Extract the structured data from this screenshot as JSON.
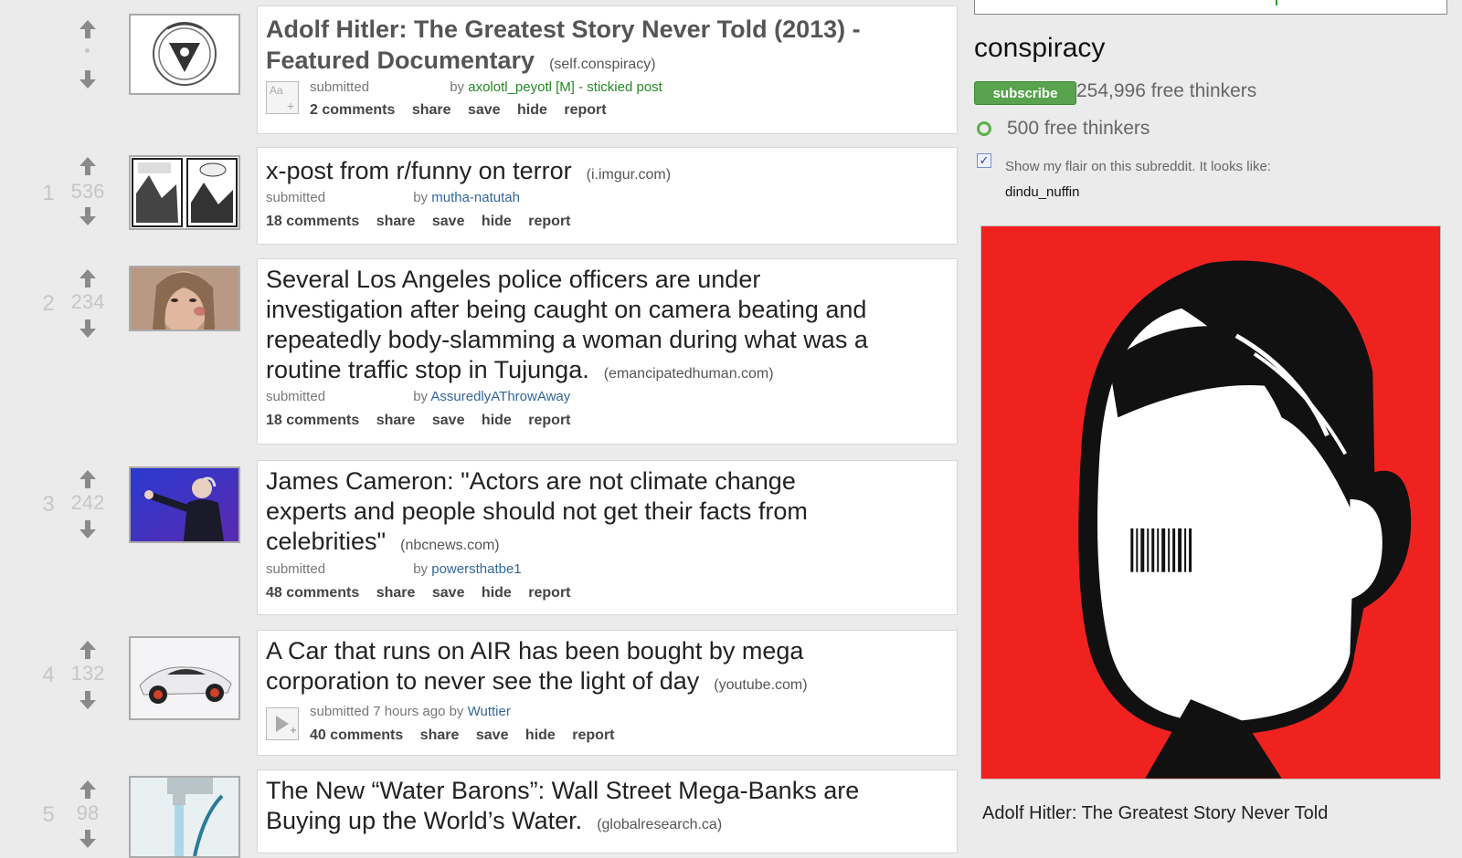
{
  "posts": [
    {
      "rank": "",
      "score": "",
      "title": "Adolf Hitler: The Greatest Story Never Told (2013) -",
      "title_line2": "Featured Documentary",
      "domain": "(self.conspiracy)",
      "submitted": "submitted",
      "by": "by",
      "author": "axolotl_peyotl",
      "author_extra": "[M] - stickied post",
      "comments": "2 comments",
      "share": "share",
      "save": "save",
      "hide": "hide",
      "report": "report"
    },
    {
      "rank": "1",
      "score": "536",
      "title": "x-post from r/funny on terror",
      "domain": "(i.imgur.com)",
      "submitted": "submitted",
      "by": "by",
      "author": "mutha-natutah",
      "comments": "18 comments",
      "share": "share",
      "save": "save",
      "hide": "hide",
      "report": "report"
    },
    {
      "rank": "2",
      "score": "234",
      "title_lines": [
        "Several Los Angeles police officers are under",
        "investigation after being caught on camera beating and",
        "repeatedly body-slamming a woman during what was a",
        "routine traffic stop in Tujunga."
      ],
      "domain": "(emancipatedhuman.com)",
      "submitted": "submitted",
      "by": "by",
      "author": "AssuredlyAThrowAway",
      "comments": "18 comments",
      "share": "share",
      "save": "save",
      "hide": "hide",
      "report": "report"
    },
    {
      "rank": "3",
      "score": "242",
      "title_lines": [
        "James Cameron: \"Actors are not climate change",
        "experts and people should not get their facts from",
        "celebrities\""
      ],
      "domain": "(nbcnews.com)",
      "submitted": "submitted",
      "by": "by",
      "author": "powersthatbe1",
      "comments": "48 comments",
      "share": "share",
      "save": "save",
      "hide": "hide",
      "report": "report"
    },
    {
      "rank": "4",
      "score": "132",
      "title_lines": [
        "A Car that runs on AIR has been bought by mega",
        "corporation to never see the light of day"
      ],
      "domain": "(youtube.com)",
      "submitted_full": "submitted 7 hours ago by",
      "author": "Wuttier",
      "comments": "40 comments",
      "share": "share",
      "save": "save",
      "hide": "hide",
      "report": "report"
    },
    {
      "rank": "5",
      "score": "98",
      "title_lines": [
        "The New “Water Barons”: Wall Street Mega-Banks are",
        "Buying up the World’s Water."
      ],
      "domain": "(globalresearch.ca)"
    }
  ],
  "sidebar": {
    "name": "conspiracy",
    "subscribe": "subscribe",
    "subscribers": "254,996 free thinkers",
    "online": "500 free thinkers",
    "flair_label": "Show my flair on this subreddit. It looks like:",
    "flair_user": "dindu_nuffin",
    "poster_caption": "Adolf Hitler: The Greatest Story Never Told"
  },
  "colors": {
    "accent_green": "#59a24e",
    "poster_red": "#f02220",
    "link_blue": "#336699"
  },
  "icons": [
    "upvote-arrow-icon",
    "downvote-arrow-icon",
    "text-post-expando-icon",
    "video-expando-icon",
    "checkbox-checked-icon"
  ]
}
